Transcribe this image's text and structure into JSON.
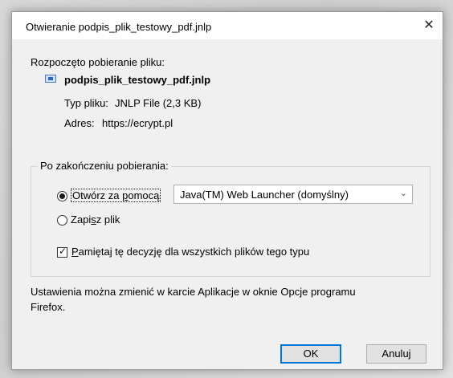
{
  "window": {
    "title": "Otwieranie podpis_plik_testowy_pdf.jnlp",
    "close_glyph": "✕"
  },
  "download": {
    "started_label": "Rozpoczęto pobieranie pliku:",
    "filename": "podpis_plik_testowy_pdf.jnlp",
    "type_label": "Typ pliku:",
    "type_value": "JNLP File (2,3 KB)",
    "address_label": "Adres:",
    "address_value": "https://ecrypt.pl"
  },
  "after_download": {
    "group_label": "Po zakończeniu pobierania:",
    "open_with": {
      "label_pre": "Otwórz za ",
      "label_underlined": "p",
      "label_post": "omocą",
      "checked": true,
      "selected_app": "Java(TM) Web Launcher (domyślny)"
    },
    "save_file": {
      "label_pre": "Zapi",
      "label_underlined": "s",
      "label_post": "z plik",
      "checked": false
    },
    "remember": {
      "label_pre": "",
      "label_underlined": "P",
      "label_post": "amiętaj tę decyzję dla wszystkich plików tego typu",
      "checked": true
    }
  },
  "note": {
    "line1": "Ustawienia można zmienić w karcie Aplikacje w oknie Opcje programu",
    "line2": "Firefox."
  },
  "buttons": {
    "ok": "OK",
    "cancel": "Anuluj"
  },
  "colors": {
    "dialog_bg": "#f0f0f0",
    "default_button_border": "#0078d7"
  },
  "icons": {
    "file": "jnlp-file-icon",
    "dropdown": "chevron-down-icon",
    "close": "close-icon"
  }
}
